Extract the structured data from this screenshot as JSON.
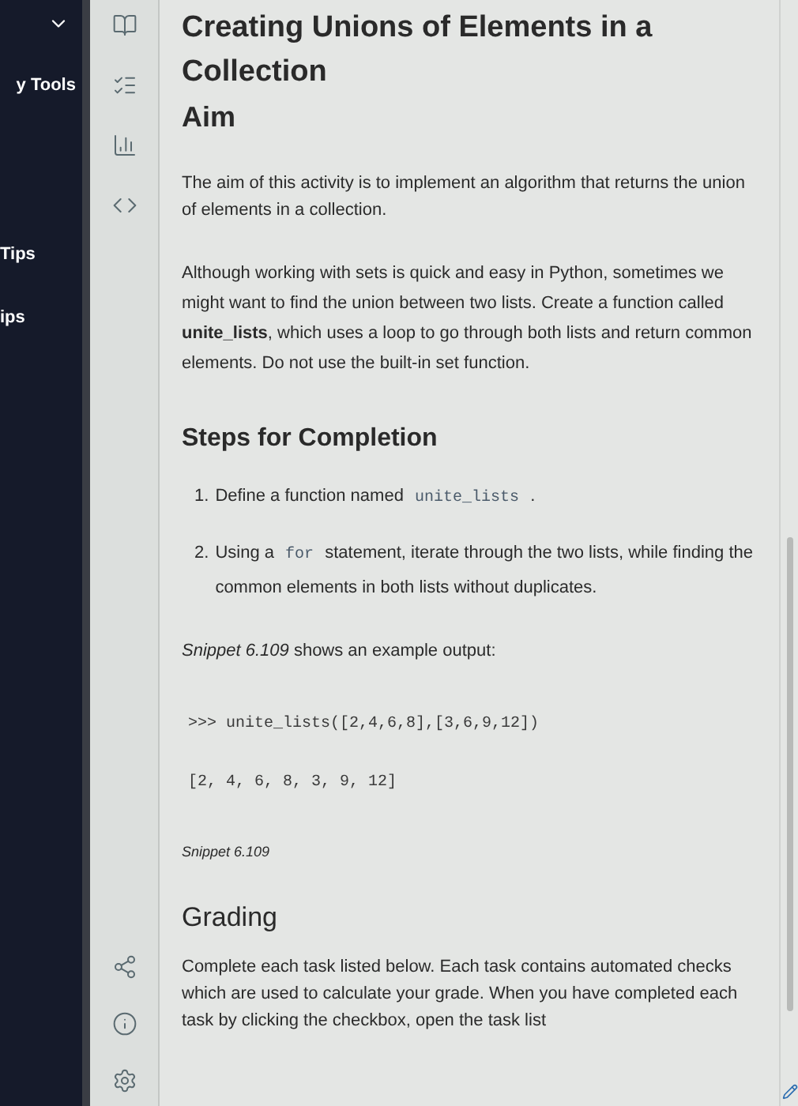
{
  "left_sidebar": {
    "items": [
      {
        "label": "y Tools"
      },
      {
        "label": "Tips"
      },
      {
        "label": "ips"
      }
    ]
  },
  "rail": {
    "top_icons": [
      {
        "kind": "book"
      },
      {
        "kind": "checklist"
      },
      {
        "kind": "chart"
      },
      {
        "kind": "code"
      }
    ],
    "bottom_icons": [
      {
        "kind": "share"
      },
      {
        "kind": "info"
      },
      {
        "kind": "gear"
      }
    ]
  },
  "content": {
    "title": "Creating Unions of Elements in a Collection",
    "aim_heading": "Aim",
    "aim_text": "The aim of this activity is to implement an algorithm that returns the union of elements in a collection.",
    "description": "Although working with sets is quick and easy in Python, sometimes we might want to find the union between two lists. Create a function called **unite_lists**, which uses a loop to go through both lists and return common elements. Do not use the built-in set function.",
    "steps_heading": "Steps for Completion",
    "steps": [
      {
        "number": "1.",
        "parts": [
          {
            "kind": "text",
            "text": "Define a function named "
          },
          {
            "kind": "code",
            "text": "unite_lists"
          },
          {
            "kind": "text",
            "text": " ."
          }
        ]
      },
      {
        "number": "2.",
        "parts": [
          {
            "kind": "text",
            "text": "Using a "
          },
          {
            "kind": "code",
            "text": "for"
          },
          {
            "kind": "text",
            "text": " statement, iterate through the two lists, while finding the common elements in both lists without duplicates."
          }
        ]
      }
    ],
    "snippet_intro": "*Snippet 6.109* shows an example output:",
    "code_lines": [
      ">>> unite_lists([2,4,6,8],[3,6,9,12])",
      "[2, 4, 6, 8, 3, 9, 12]"
    ],
    "snippet_caption": "Snippet 6.109",
    "grading_heading": "Grading",
    "grading_text": "Complete each task listed below. Each task contains automated checks which are used to calculate your grade. When you have completed each task by clicking the checkbox, open the task list"
  }
}
